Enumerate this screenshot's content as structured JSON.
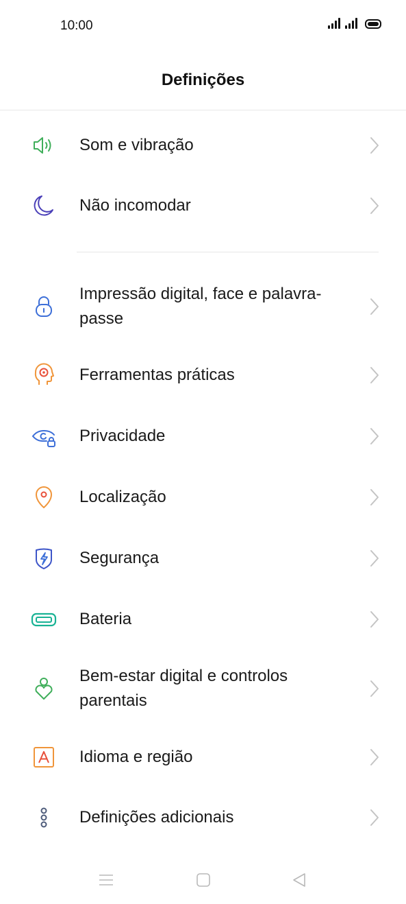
{
  "status_bar": {
    "time": "10:00"
  },
  "header": {
    "title": "Definições"
  },
  "settings": [
    {
      "label": "Som e vibração",
      "icon": "speaker-icon",
      "color": "#3fae5a"
    },
    {
      "label": "Não incomodar",
      "icon": "moon-icon",
      "color": "#4a3fb8"
    },
    {
      "label": "Impressão digital, face e palavra-passe",
      "icon": "lock-icon",
      "color": "#3d6fd8"
    },
    {
      "label": "Ferramentas práticas",
      "icon": "head-target-icon",
      "color": "#f0953a"
    },
    {
      "label": "Privacidade",
      "icon": "eye-lock-icon",
      "color": "#3d6fd8"
    },
    {
      "label": "Localização",
      "icon": "location-pin-icon",
      "color": "#f0953a"
    },
    {
      "label": "Segurança",
      "icon": "shield-bolt-icon",
      "color": "#3d55c8"
    },
    {
      "label": "Bateria",
      "icon": "battery-icon",
      "color": "#18b294"
    },
    {
      "label": "Bem-estar digital e controlos parentais",
      "icon": "person-heart-icon",
      "color": "#3fae5a"
    },
    {
      "label": "Idioma e região",
      "icon": "letter-a-icon",
      "color": "#f0953a"
    },
    {
      "label": "Definições adicionais",
      "icon": "dots-icon",
      "color": "#4d5b7a"
    }
  ],
  "colors": {
    "chevron": "#c4c4c4",
    "divider": "#e7e7e7",
    "nav": "#b9b9b9"
  }
}
